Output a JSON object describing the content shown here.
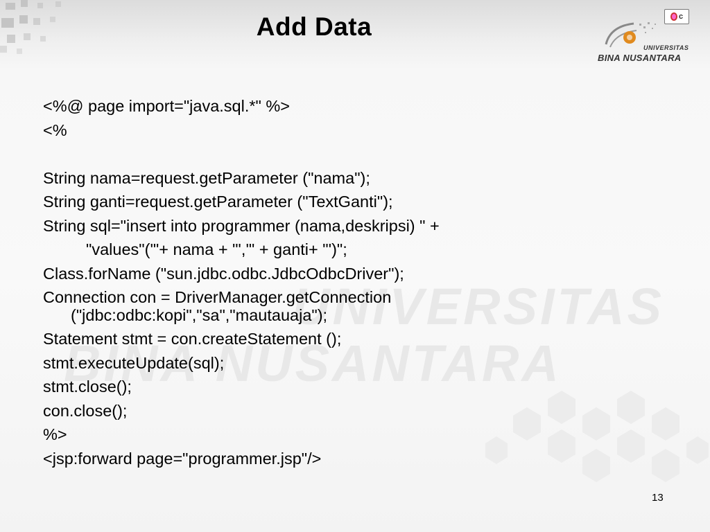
{
  "slide": {
    "title": "Add Data",
    "page_number": "13"
  },
  "logo": {
    "badge_letter": "c",
    "university_label": "UNIVERSITAS",
    "name": "BINA NUSANTARA"
  },
  "watermark": {
    "line1": "UNIVERSITAS",
    "line2": "BINA NUSANTARA"
  },
  "code_lines": [
    "<%@ page import=\"java.sql.*\" %>",
    "<%",
    "",
    "String nama=request.getParameter (\"nama\");",
    "String ganti=request.getParameter (\"TextGanti\");",
    "String sql=\"insert into programmer (nama,deskripsi) \" +",
    "\"values\"('\"+ nama + \"','\" + ganti+ \"')\";",
    "Class.forName (\"sun.jdbc.odbc.JdbcOdbcDriver\");",
    "Connection con = DriverManager.getConnection",
    "(\"jdbc:odbc:kopi\",\"sa\",\"mautauaja\");",
    "Statement stmt = con.createStatement ();",
    "stmt.executeUpdate(sql);",
    "stmt.close();",
    "con.close();",
    "%>",
    "<jsp:forward page=\"programmer.jsp\"/>"
  ],
  "icons": [
    "university-logo-icon",
    "cd-badge-icon"
  ]
}
